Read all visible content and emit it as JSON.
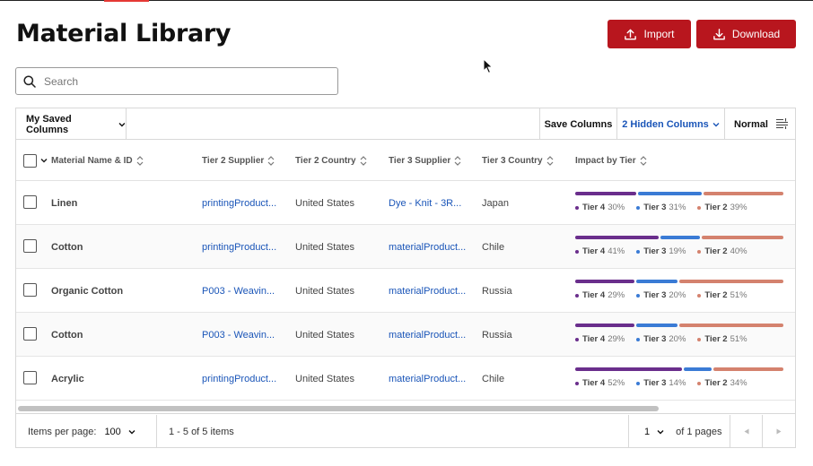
{
  "page": {
    "title": "Material Library"
  },
  "actions": {
    "import_label": "Import",
    "download_label": "Download"
  },
  "search": {
    "placeholder": "Search",
    "value": ""
  },
  "toolbar": {
    "saved_columns_label": "My Saved Columns",
    "save_columns_label": "Save Columns",
    "hidden_columns_label": "2 Hidden Columns",
    "density_label": "Normal"
  },
  "columns": [
    "Material Name & ID",
    "Tier 2 Supplier",
    "Tier 2 Country",
    "Tier 3 Supplier",
    "Tier 3 Country",
    "Impact by Tier"
  ],
  "tier_colors": {
    "Tier 4": "#6a2e8c",
    "Tier 3": "#3a7bd5",
    "Tier 2": "#d4826e"
  },
  "rows": [
    {
      "name": "Linen",
      "t2_supplier": "printingProduct...",
      "t2_country": "United States",
      "t3_supplier": "Dye - Knit - 3R...",
      "t3_country": "Japan",
      "impact": [
        {
          "tier": "Tier 4",
          "pct": "30%",
          "value": 30
        },
        {
          "tier": "Tier 3",
          "pct": "31%",
          "value": 31
        },
        {
          "tier": "Tier 2",
          "pct": "39%",
          "value": 39
        }
      ]
    },
    {
      "name": "Cotton",
      "t2_supplier": "printingProduct...",
      "t2_country": "United States",
      "t3_supplier": "materialProduct...",
      "t3_country": "Chile",
      "impact": [
        {
          "tier": "Tier 4",
          "pct": "41%",
          "value": 41
        },
        {
          "tier": "Tier 3",
          "pct": "19%",
          "value": 19
        },
        {
          "tier": "Tier 2",
          "pct": "40%",
          "value": 40
        }
      ]
    },
    {
      "name": "Organic Cotton",
      "t2_supplier": "P003 - Weavin...",
      "t2_country": "United States",
      "t3_supplier": "materialProduct...",
      "t3_country": "Russia",
      "impact": [
        {
          "tier": "Tier 4",
          "pct": "29%",
          "value": 29
        },
        {
          "tier": "Tier 3",
          "pct": "20%",
          "value": 20
        },
        {
          "tier": "Tier 2",
          "pct": "51%",
          "value": 51
        }
      ]
    },
    {
      "name": "Cotton",
      "t2_supplier": "P003 - Weavin...",
      "t2_country": "United States",
      "t3_supplier": "materialProduct...",
      "t3_country": "Russia",
      "impact": [
        {
          "tier": "Tier 4",
          "pct": "29%",
          "value": 29
        },
        {
          "tier": "Tier 3",
          "pct": "20%",
          "value": 20
        },
        {
          "tier": "Tier 2",
          "pct": "51%",
          "value": 51
        }
      ]
    },
    {
      "name": "Acrylic",
      "t2_supplier": "printingProduct...",
      "t2_country": "United States",
      "t3_supplier": "materialProduct...",
      "t3_country": "Chile",
      "impact": [
        {
          "tier": "Tier 4",
          "pct": "52%",
          "value": 52
        },
        {
          "tier": "Tier 3",
          "pct": "14%",
          "value": 14
        },
        {
          "tier": "Tier 2",
          "pct": "34%",
          "value": 34
        }
      ]
    }
  ],
  "pagination": {
    "items_per_page_label": "Items per page:",
    "items_per_page_value": "100",
    "range_label": "1 - 5 of 5 items",
    "page_value": "1",
    "page_total_label": "of 1 pages"
  }
}
